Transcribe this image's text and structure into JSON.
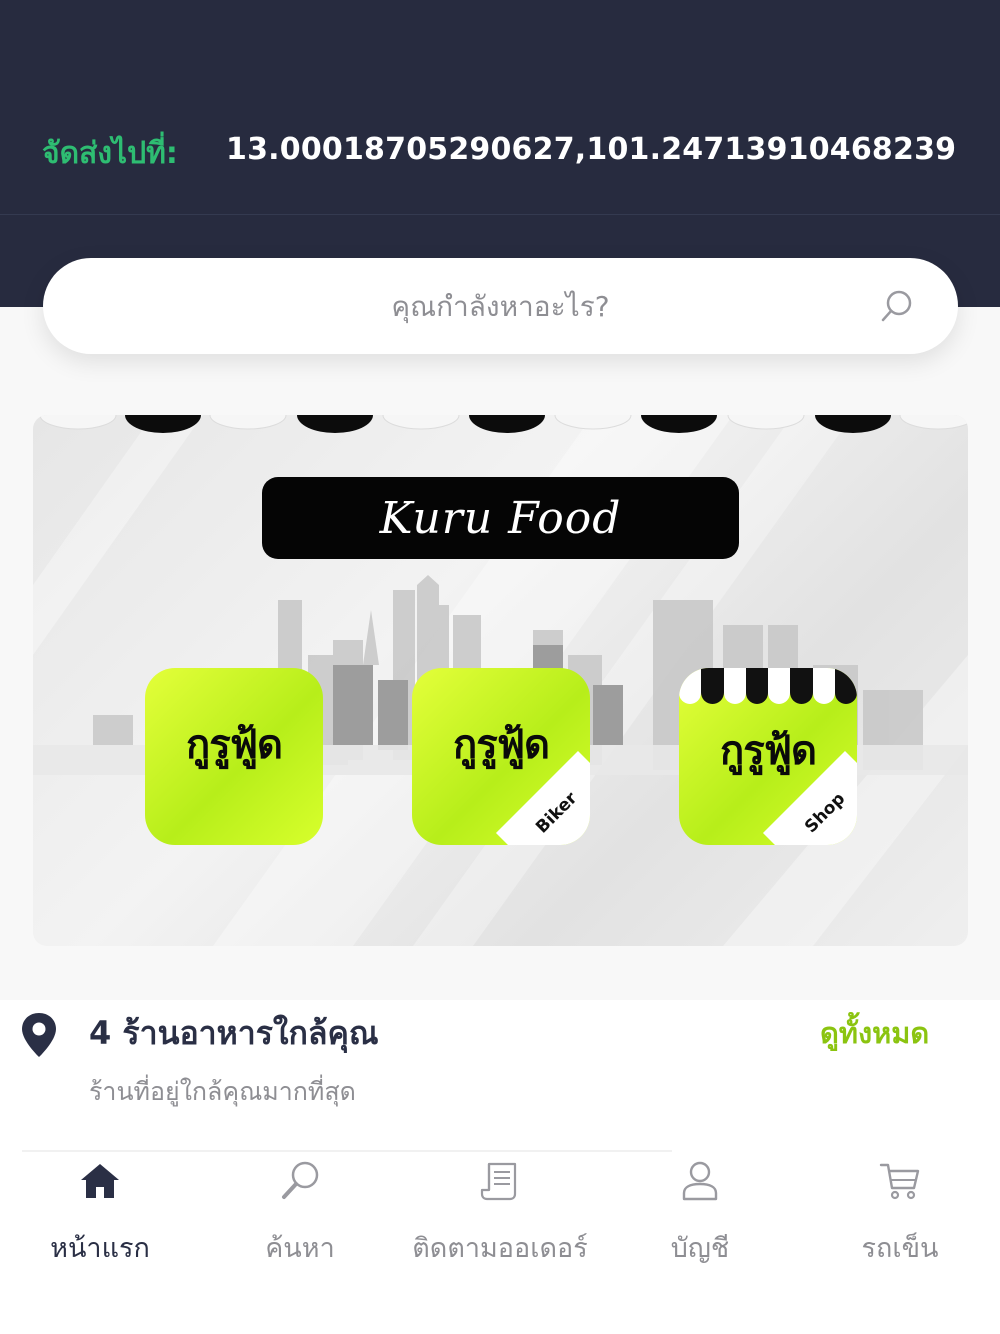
{
  "header": {
    "deliver_label": "จัดส่งไปที่:",
    "deliver_value": "13.00018705290627,101.24713910468239",
    "background_color": "#272b3f",
    "label_color": "#2ebd72"
  },
  "search": {
    "placeholder": "คุณกำลังหาอะไร?",
    "icon": "search-icon"
  },
  "banner": {
    "title": "Kuru Food",
    "apps": [
      {
        "brand": "กูรูฟู้ด",
        "tag": ""
      },
      {
        "brand": "กูรูฟู้ด",
        "tag": "Biker"
      },
      {
        "brand": "กูรูฟู้ด",
        "tag": "Shop"
      }
    ],
    "accent_color": "#c8f523"
  },
  "nearby": {
    "icon": "location-pin-icon",
    "title": "4 ร้านอาหารใกล้คุณ",
    "subtitle": "ร้านที่อยู่ใกล้คุณมากที่สุด",
    "see_all": "ดูทั้งหมด",
    "see_all_color": "#8bc410"
  },
  "bottom_nav": {
    "items": [
      {
        "label": "หน้าแรก",
        "icon": "home-icon",
        "active": true
      },
      {
        "label": "ค้นหา",
        "icon": "magnifier-icon",
        "active": false
      },
      {
        "label": "ติดตามออเดอร์",
        "icon": "receipt-icon",
        "active": false
      },
      {
        "label": "บัญชี",
        "icon": "user-icon",
        "active": false
      },
      {
        "label": "รถเข็น",
        "icon": "cart-icon",
        "active": false
      }
    ]
  }
}
